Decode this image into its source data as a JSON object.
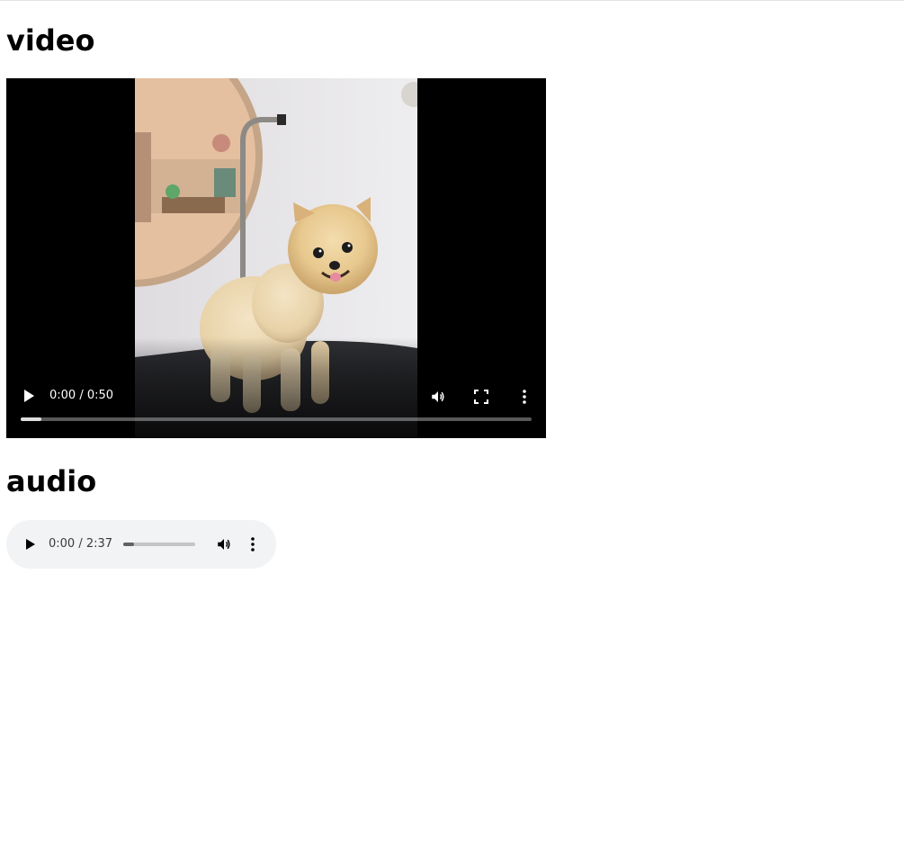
{
  "headings": {
    "video": "video",
    "audio": "audio"
  },
  "video": {
    "current_time": "0:00",
    "separator": "/",
    "duration": "0:50",
    "time_display": "0:00 / 0:50",
    "buffered_fraction": 0.04,
    "controls": {
      "play_icon": "play-icon",
      "mute_icon": "volume-icon",
      "fullscreen_icon": "fullscreen-icon",
      "more_icon": "more-vertical-icon"
    },
    "poster": "pomeranian dog standing on grooming table"
  },
  "audio": {
    "current_time": "0:00",
    "separator": "/",
    "duration": "2:37",
    "time_display": "0:00 / 2:37",
    "buffered_fraction": 0.15,
    "controls": {
      "play_icon": "play-icon",
      "mute_icon": "volume-icon",
      "more_icon": "more-vertical-icon"
    }
  },
  "colors": {
    "audio_background": "#f1f3f4",
    "video_background": "#000000"
  }
}
